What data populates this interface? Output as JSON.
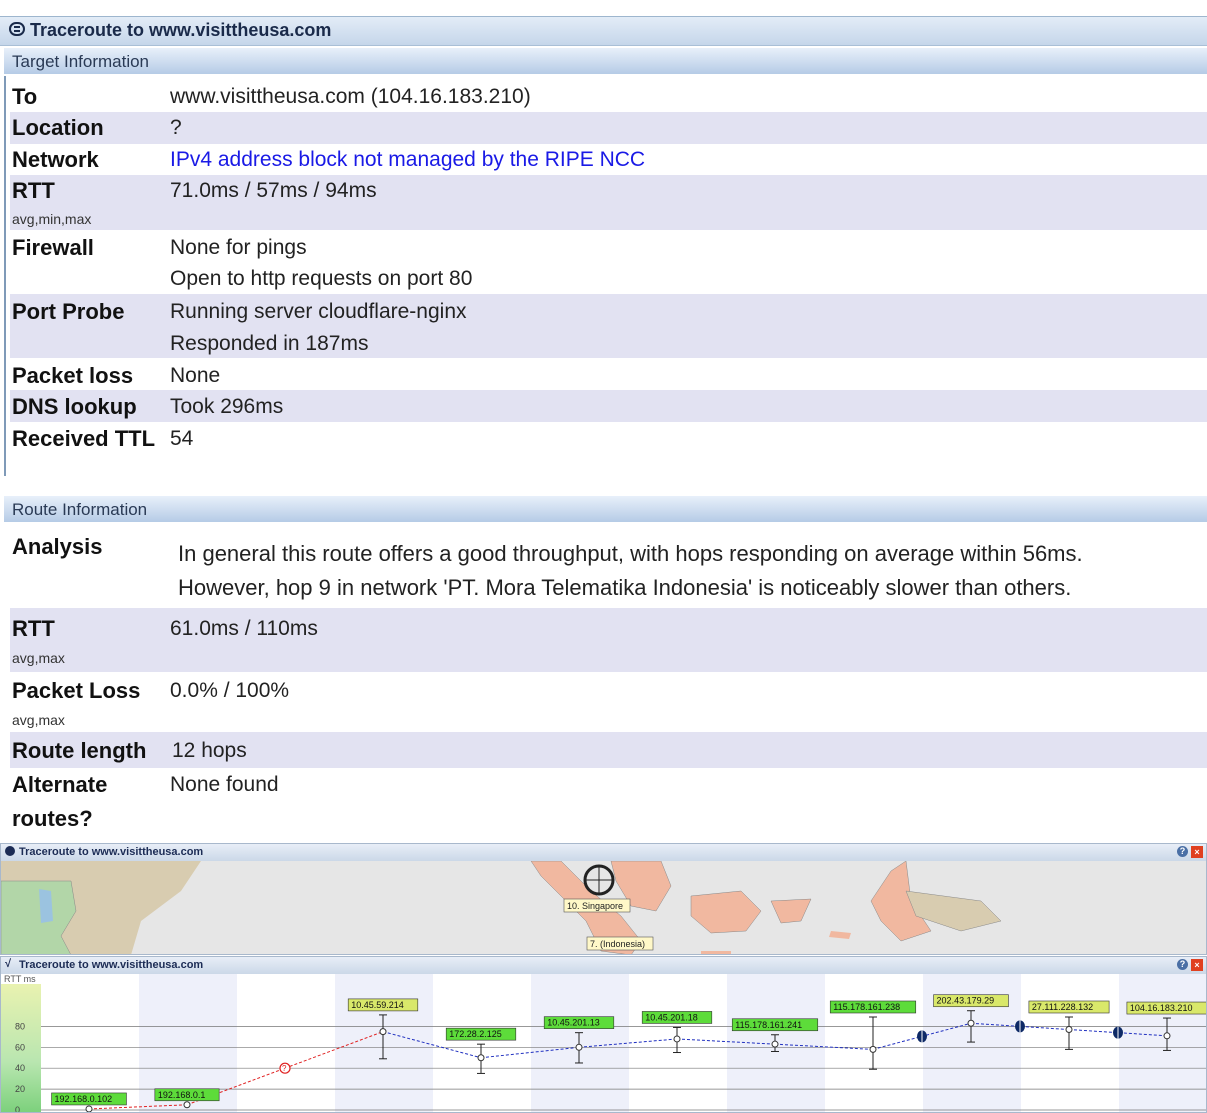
{
  "window": {
    "title": "Traceroute to www.visittheusa.com"
  },
  "target": {
    "header": "Target Information",
    "rows": [
      {
        "label": "To",
        "values": [
          "www.visittheusa.com (104.16.183.210)"
        ]
      },
      {
        "label": "Location",
        "values": [
          "?"
        ]
      },
      {
        "label": "Network",
        "values": [
          "IPv4 address block not managed by the RIPE NCC"
        ]
      },
      {
        "label": "RTT",
        "sub": "avg,min,max",
        "values": [
          "71.0ms / 57ms / 94ms"
        ]
      },
      {
        "label": "Firewall",
        "values": [
          "None for pings",
          "Open to http requests on port 80"
        ]
      },
      {
        "label": "Port Probe",
        "values": [
          "Running server cloudflare-nginx",
          "Responded in 187ms"
        ]
      },
      {
        "label": "Packet loss",
        "values": [
          "None"
        ]
      },
      {
        "label": "DNS lookup",
        "values": [
          "Took 296ms"
        ]
      },
      {
        "label": "Received TTL",
        "values": [
          "54"
        ]
      }
    ]
  },
  "route": {
    "header": "Route Information",
    "analysis_label": "Analysis",
    "analysis_lines": [
      "In general this route offers a good throughput, with hops responding on average within 56ms.",
      "However, hop 9 in network 'PT. Mora Telematika Indonesia' is noticeably slower than others."
    ],
    "rtt_label": "RTT",
    "rtt_sub": "avg,max",
    "rtt_value": "61.0ms / 110ms",
    "loss_label": "Packet Loss",
    "loss_sub": "avg,max",
    "loss_value": "0.0% / 100%",
    "length_label": "Route length",
    "length_value": "12 hops",
    "alt_label_1": "Alternate",
    "alt_label_2": "routes?",
    "alt_value": "None found"
  },
  "map_panel": {
    "title": "Traceroute to www.visittheusa.com",
    "labels": [
      "10. Singapore",
      "7. (Indonesia)"
    ]
  },
  "rtt_panel": {
    "title": "Traceroute to www.visittheusa.com",
    "y_axis_label": "RTT ms",
    "y_ticks": [
      "0",
      "20",
      "40",
      "60",
      "80"
    ]
  },
  "chart_data": {
    "type": "line",
    "title": "",
    "ylabel": "RTT ms",
    "ylim": [
      0,
      100
    ],
    "ticks": [
      0,
      20,
      40,
      60,
      80
    ],
    "grid": true,
    "series": [
      {
        "points": [
          {
            "hop": 1,
            "label": "192.168.0.102",
            "rtt": 1,
            "min": 1,
            "max": 1
          },
          {
            "hop": 2,
            "label": "192.168.0.1",
            "rtt": 5,
            "min": 5,
            "max": 5
          },
          {
            "hop": 3,
            "label": "?",
            "rtt": 40,
            "min": 40,
            "max": 40
          },
          {
            "hop": 4,
            "label": "10.45.59.214",
            "rtt": 75,
            "min": 49,
            "max": 91
          },
          {
            "hop": 5,
            "label": "172.28.2.125",
            "rtt": 50,
            "min": 35,
            "max": 63
          },
          {
            "hop": 6,
            "label": "10.45.201.13",
            "rtt": 60,
            "min": 45,
            "max": 74
          },
          {
            "hop": 7,
            "label": "10.45.201.18",
            "rtt": 68,
            "min": 55,
            "max": 79
          },
          {
            "hop": 8,
            "label": "115.178.161.241",
            "rtt": 63,
            "min": 56,
            "max": 72
          },
          {
            "hop": 9,
            "label": "115.178.161.238",
            "rtt": 58,
            "min": 39,
            "max": 89
          },
          {
            "hop": 10,
            "label": "202.43.179.29",
            "rtt": 83,
            "min": 65,
            "max": 95
          },
          {
            "hop": 11,
            "label": "27.111.228.132",
            "rtt": 77,
            "min": 58,
            "max": 89
          },
          {
            "hop": 12,
            "label": "104.16.183.210",
            "rtt": 71,
            "min": 57,
            "max": 88
          }
        ]
      }
    ]
  }
}
